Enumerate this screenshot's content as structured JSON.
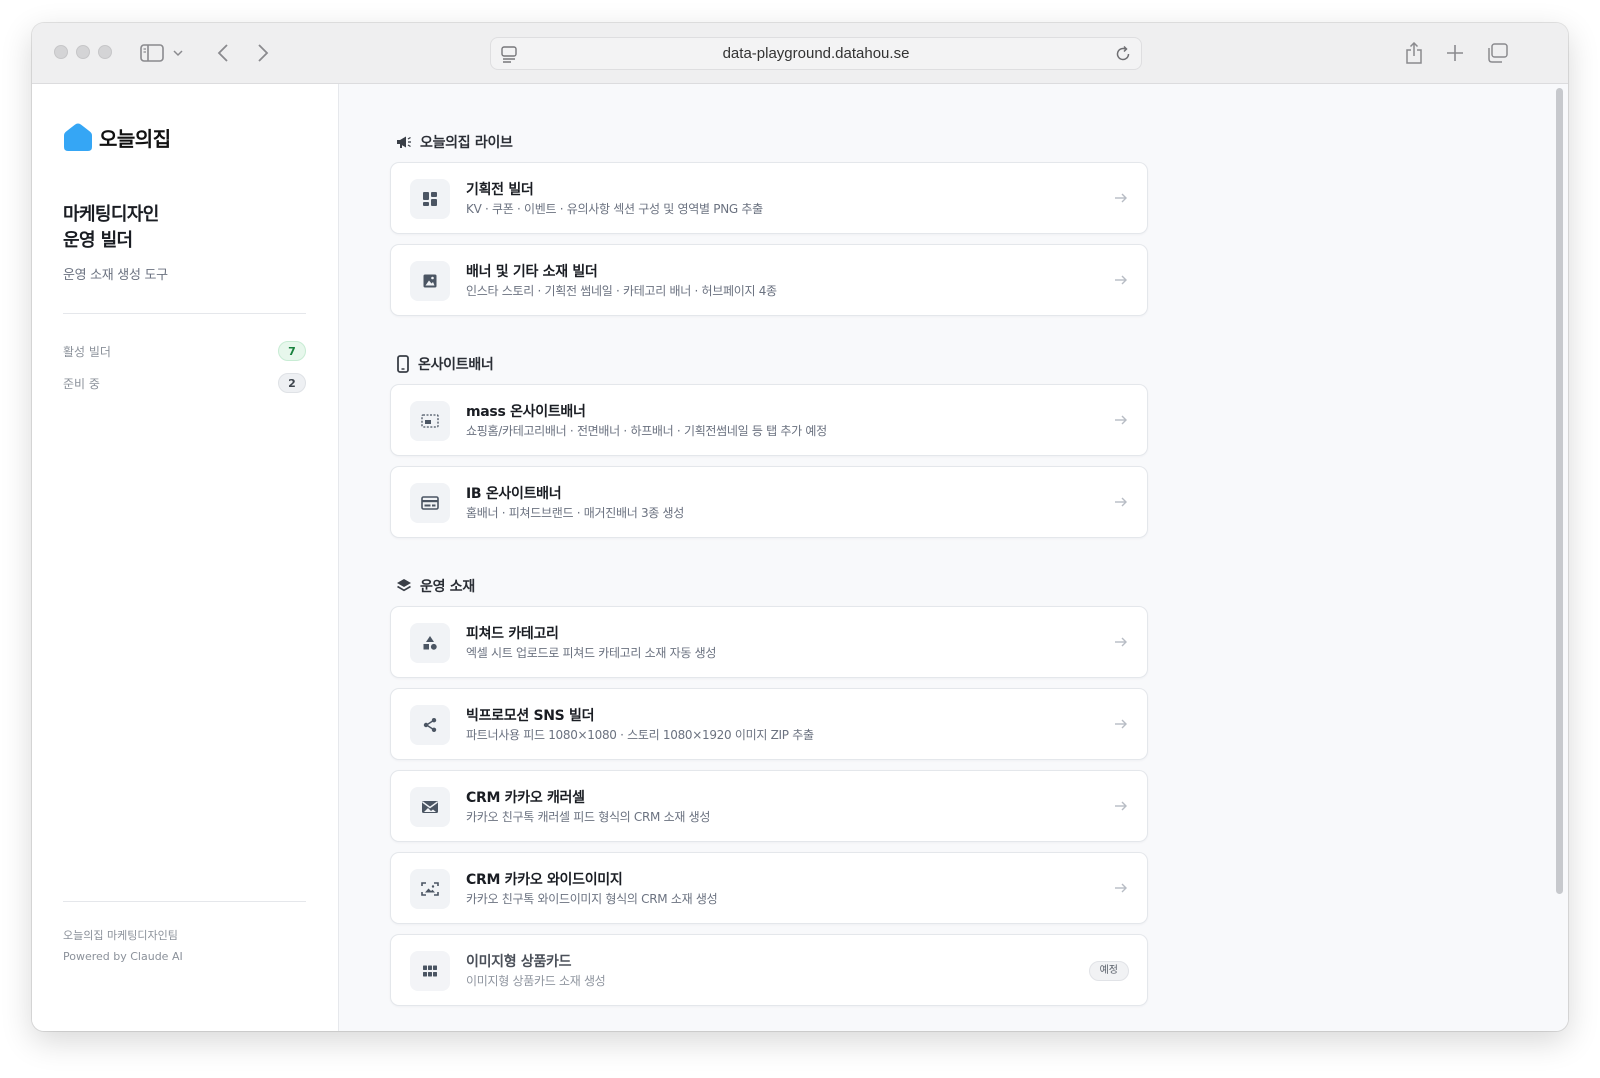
{
  "browser": {
    "url": "data-playground.datahou.se"
  },
  "sidebar": {
    "logo_text": "오늘의집",
    "title_line1": "마케팅디자인",
    "title_line2": "운영 빌더",
    "subtitle": "운영 소재 생성 도구",
    "stats": [
      {
        "label": "활성 빌더",
        "count": "7"
      },
      {
        "label": "준비 중",
        "count": "2"
      }
    ],
    "footer_line1": "오늘의집 마케팅디자인팀",
    "footer_line2": "Powered by Claude AI"
  },
  "sections": [
    {
      "title": "오늘의집 라이브",
      "icon": "megaphone-icon",
      "cards": [
        {
          "title": "기획전 빌더",
          "desc": "KV · 쿠폰 · 이벤트 · 유의사항 섹션 구성 및 영역별 PNG 추출",
          "icon": "dashboard-icon"
        },
        {
          "title": "배너 및 기타 소재 빌더",
          "desc": "인스타 스토리 · 기획전 썸네일 · 카테고리 배너 · 허브페이지 4종",
          "icon": "image-icon"
        }
      ]
    },
    {
      "title": "온사이트배너",
      "icon": "mobile-icon",
      "cards": [
        {
          "title": "mass 온사이트배너",
          "desc": "쇼핑홈/카테고리배너 · 전면배너 · 하프배너 · 기획전썸네일 등 탭 추가 예정",
          "icon": "banner-frame-icon"
        },
        {
          "title": "IB 온사이트배너",
          "desc": "홈배너 · 피쳐드브랜드 · 매거진배너 3종 생성",
          "icon": "card-icon"
        }
      ]
    },
    {
      "title": "운영 소재",
      "icon": "layers-icon",
      "cards": [
        {
          "title": "피쳐드 카테고리",
          "desc": "엑셀 시트 업로드로 피쳐드 카테고리 소재 자동 생성",
          "icon": "shapes-icon"
        },
        {
          "title": "빅프로모션 SNS 빌더",
          "desc": "파트너사용 피드 1080×1080 · 스토리 1080×1920 이미지 ZIP 추출",
          "icon": "share-icon"
        },
        {
          "title": "CRM 카카오 캐러셀",
          "desc": "카카오 친구톡 캐러셀 피드 형식의 CRM 소재 생성",
          "icon": "mail-image-icon"
        },
        {
          "title": "CRM 카카오 와이드이미지",
          "desc": "카카오 친구톡 와이드이미지 형식의 CRM 소재 생성",
          "icon": "wide-image-icon"
        },
        {
          "title": "이미지형 상품카드",
          "desc": "이미지형 상품카드 소재 생성",
          "icon": "grid-icon",
          "badge": "예정"
        }
      ]
    }
  ],
  "colors": {
    "brand": "#35a6f5",
    "accent_green": "#18813d"
  }
}
